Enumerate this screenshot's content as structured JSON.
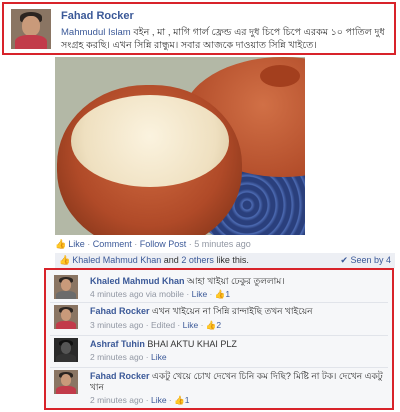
{
  "post": {
    "author": "Fahad Rocker",
    "mention": "Mahmudul Islam",
    "text": " বইন , মা ,  মাগি গার্ল ফ্রেন্ড এর দুধ চিপে চিপে এরকম ১০ পাতিল দুধ সংগ্রহ করছি। এখন সিন্নি রান্ধুম। সবার আজকে দাওয়াত সিন্নি খাইতে।"
  },
  "actions": {
    "like": "Like",
    "comment": "Comment",
    "follow": "Follow Post",
    "time": "5 minutes ago"
  },
  "likes_bar": {
    "names": "Khaled Mahmud Khan",
    "and": "and",
    "others": "2 others",
    "suffix": "like this.",
    "seen": "Seen by 4"
  },
  "comments": [
    {
      "author": "Khaled Mahmud Khan",
      "text": "আহা খাইয়া ঢেকুর তুললাম।",
      "meta_time": "4 minutes ago via mobile",
      "like": "Like",
      "likes": "1"
    },
    {
      "author": "Fahad Rocker",
      "text": "এখন খাইয়েন না সিন্নি রান্দাইছি তখন খাইয়েন",
      "meta_time": "3 minutes ago · Edited",
      "like": "Like",
      "likes": "2"
    },
    {
      "author": "Ashraf Tuhin",
      "text": "BHAI AKTU KHAI PLZ",
      "meta_time": "2 minutes ago",
      "like": "Like",
      "likes": ""
    },
    {
      "author": "Fahad Rocker",
      "text": "একটু খেয়ে চোখ দেখেন চিনি কম দিছি? মিষ্টি না টক। দেখেন একটু খান",
      "meta_time": "2 minutes ago",
      "like": "Like",
      "likes": "1"
    }
  ],
  "colors": {
    "accent": "#3b5998",
    "highlight_border": "#d8232a"
  }
}
